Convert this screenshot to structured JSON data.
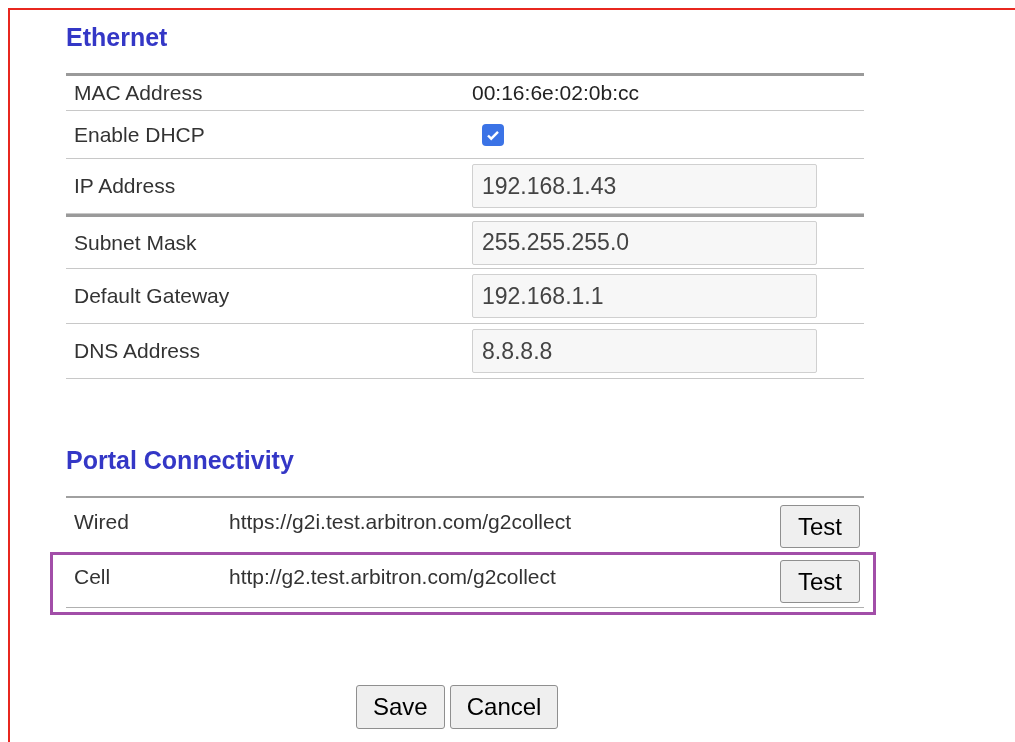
{
  "ethernet": {
    "title": "Ethernet",
    "rows": [
      {
        "kind": "text",
        "label": "MAC Address",
        "value": "00:16:6e:02:0b:cc"
      },
      {
        "kind": "checkbox",
        "label": "Enable DHCP",
        "checked": true
      },
      {
        "kind": "input",
        "label": "IP Address",
        "value": "192.168.1.43"
      },
      {
        "kind": "input",
        "label": "Subnet Mask",
        "value": "255.255.255.0"
      },
      {
        "kind": "input",
        "label": "Default Gateway",
        "value": "192.168.1.1"
      },
      {
        "kind": "input",
        "label": "DNS Address",
        "value": "8.8.8.8"
      }
    ]
  },
  "portal": {
    "title": "Portal Connectivity",
    "rows": [
      {
        "label": "Wired",
        "url": "https://g2i.test.arbitron.com/g2collect",
        "button": "Test",
        "highlighted": false
      },
      {
        "label": "Cell",
        "url": "http://g2.test.arbitron.com/g2collect",
        "button": "Test",
        "highlighted": true
      }
    ]
  },
  "buttons": [
    "Save",
    "Cancel"
  ]
}
